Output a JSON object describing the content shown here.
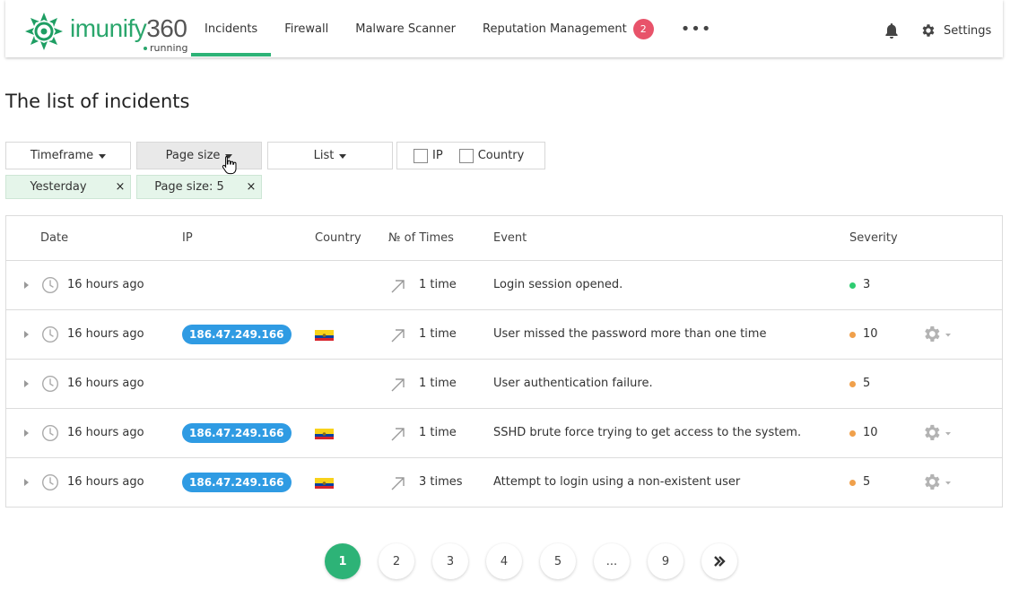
{
  "brand": {
    "name_text": "imunify",
    "name_num": "360",
    "status": "running",
    "accent": "#2db377"
  },
  "nav": [
    {
      "label": "Incidents",
      "active": true
    },
    {
      "label": "Firewall"
    },
    {
      "label": "Malware Scanner"
    },
    {
      "label": "Reputation Management",
      "badge": "2"
    }
  ],
  "nav_more": "•••",
  "settings_label": "Settings",
  "page_title": "The list of incidents",
  "filters": {
    "timeframe": "Timeframe",
    "page_size": "Page size",
    "list": "List",
    "ip_check": "IP",
    "country_check": "Country"
  },
  "chips": {
    "yesterday": "Yesterday",
    "page_size": "Page size: 5",
    "remove": "×"
  },
  "table": {
    "headers": {
      "date": "Date",
      "ip": "IP",
      "country": "Country",
      "times": "№ of Times",
      "event": "Event",
      "severity": "Severity"
    },
    "rows": [
      {
        "date": "16 hours ago",
        "ip": "",
        "country_flag": "",
        "times": "1 time",
        "event": "Login session opened.",
        "severity": "3",
        "severity_color": "#2ecc71",
        "has_actions": false
      },
      {
        "date": "16 hours ago",
        "ip": "186.47.249.166",
        "country_flag": "ecuador",
        "times": "1 time",
        "event": "User missed the password more than one time",
        "severity": "10",
        "severity_color": "#f0a04b",
        "has_actions": true
      },
      {
        "date": "16 hours ago",
        "ip": "",
        "country_flag": "",
        "times": "1 time",
        "event": "User authentication failure.",
        "severity": "5",
        "severity_color": "#f0a04b",
        "has_actions": false
      },
      {
        "date": "16 hours ago",
        "ip": "186.47.249.166",
        "country_flag": "ecuador",
        "times": "1 time",
        "event": "SSHD brute force trying to get access to the system.",
        "severity": "10",
        "severity_color": "#f0a04b",
        "has_actions": true
      },
      {
        "date": "16 hours ago",
        "ip": "186.47.249.166",
        "country_flag": "ecuador",
        "times": "3 times",
        "event": "Attempt to login using a non-existent user",
        "severity": "5",
        "severity_color": "#f0a04b",
        "has_actions": true
      }
    ]
  },
  "pagination": [
    "1",
    "2",
    "3",
    "4",
    "5",
    "...",
    "9"
  ],
  "pagination_current": "1"
}
